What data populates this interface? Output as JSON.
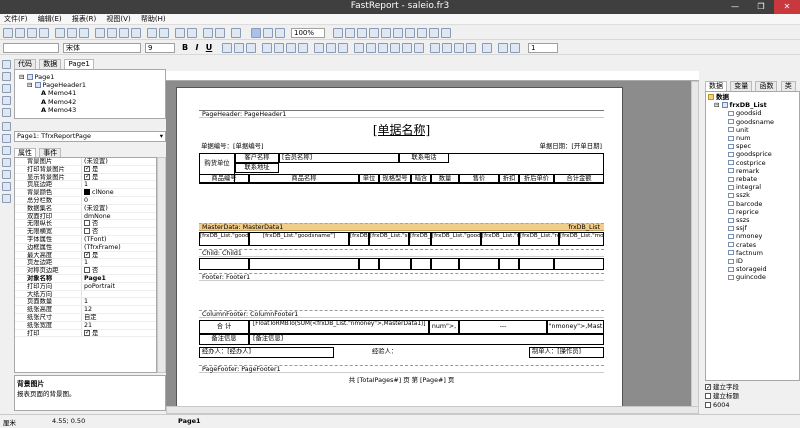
{
  "window": {
    "title": "FastReport - saleio.fr3"
  },
  "menu": [
    "文件(F)",
    "编辑(E)",
    "报表(R)",
    "视图(V)",
    "帮助(H)"
  ],
  "format_toolbar": {
    "font_name": "宋体",
    "font_size": "9",
    "zoom": "100%",
    "line_width": "1"
  },
  "left_tabs": [
    "代码",
    "数据",
    "Page1"
  ],
  "tree": [
    "Page1",
    "PageHeader1",
    "Memo41",
    "Memo42",
    "Memo43"
  ],
  "object_selector": "Page1: TfrxReportPage",
  "prop_tabs": [
    "属性",
    "事件"
  ],
  "props": [
    {
      "k": "背景图片",
      "v": "(未设置)"
    },
    {
      "k": "打印背景图片",
      "v": "是",
      "chk": true
    },
    {
      "k": "显示背景图片",
      "v": "是",
      "chk": true
    },
    {
      "k": "页底边距",
      "v": "1"
    },
    {
      "k": "背景颜色",
      "v": "clNone",
      "sw": true
    },
    {
      "k": "总分栏数",
      "v": "0"
    },
    {
      "k": "数据集名",
      "v": "(未设置)"
    },
    {
      "k": "双面打印",
      "v": "dmNone"
    },
    {
      "k": "无限纵长",
      "v": "否",
      "chk": false
    },
    {
      "k": "无限横宽",
      "v": "否",
      "chk": false
    },
    {
      "k": "字体属性",
      "v": "(TFont)"
    },
    {
      "k": "边框属性",
      "v": "(TfrxFrame)"
    },
    {
      "k": "最大高度",
      "v": "是",
      "chk": true
    },
    {
      "k": "页左边距",
      "v": "1"
    },
    {
      "k": "对称页边距",
      "v": "否",
      "chk": false
    },
    {
      "k": "对象名称",
      "v": "Page1",
      "bold": true
    },
    {
      "k": "打印方向",
      "v": "poPortrait"
    },
    {
      "k": "大纸方向",
      "v": ""
    },
    {
      "k": "页面数量",
      "v": "1"
    },
    {
      "k": "纸张高度",
      "v": "12"
    },
    {
      "k": "纸张尺寸",
      "v": "自定"
    },
    {
      "k": "纸张宽度",
      "v": "21"
    },
    {
      "k": "打印",
      "v": "是",
      "chk": true
    }
  ],
  "prop_help": {
    "title": "背景图片",
    "desc": "报表页面的背景图。"
  },
  "report": {
    "page_header_label": "PageHeader: PageHeader1",
    "title": "[单据名称]",
    "doc_no": "单据编号：[单据编号]",
    "doc_date": "单据日期：[开单日期]",
    "buy_unit": "购货单位",
    "customer_name_label": "客户名称",
    "customer_name": "[会员名称]",
    "contact_phone": "联系电话",
    "contact_address": "联系地址",
    "columns": [
      "商品编号",
      "商品名称",
      "单位",
      "规格型号",
      "暗含",
      "数量",
      "售价",
      "折扣",
      "折后单价",
      "合计金额"
    ],
    "master_label": "MasterData: MasterData1",
    "master_dataset": "frxDB_List",
    "master_cells": [
      "[frxDB_List.\"goodsid\"]",
      "[frxDB_List.\"goodsname\"]",
      "[frxDB_List.\"un",
      "[frxDB_List.\"spec\"]",
      "[frxDB_List",
      "[frxDB_List.\"goodspr",
      "[frxDB_List.\"re",
      "[frxDB_List.\"repri",
      "[frxDB_List.\"money\"]"
    ],
    "child_label": "Child: Child1",
    "footer_label": "Footer: Footer1",
    "column_footer_label": "ColumnFooter: ColumnFooter1",
    "total_label": "合    计",
    "total_expr": "[FloatToRMBTo(SUM(<frxDB_List.\"nmoney\">,MasterData1)]",
    "total_mid": "num\">,",
    "total_dash": "---",
    "total_right": "\"nmoney\">,Mast",
    "note_label": "备注信息",
    "note_val": "[备注信息]",
    "handler": "经办人：[经办人]",
    "checker": "经验人：",
    "maker": "制单人：[操作员]",
    "page_footer_label": "PageFooter: PageFooter1",
    "page_footer_text": "共 [TotalPages#] 页 第 [Page#] 页"
  },
  "right_tabs": [
    "数据",
    "变量",
    "函数",
    "类"
  ],
  "data_tree_root": "数据",
  "data_dataset": "frxDB_List",
  "data_fields": [
    "goodsid",
    "goodsname",
    "unit",
    "num",
    "spec",
    "goodsprice",
    "costprice",
    "remark",
    "rebate",
    "integral",
    "sszk",
    "barcode",
    "reprice",
    "sszs",
    "ssjf",
    "nmoney",
    "crates",
    "factnum",
    "ID",
    "storageid",
    "guincode"
  ],
  "right_options": [
    {
      "label": "建立字段",
      "on": true
    },
    {
      "label": "建立标题",
      "on": false
    },
    {
      "label": "6004",
      "on": false
    }
  ],
  "status": {
    "unit": "厘米",
    "coords": "4.55; 0.50",
    "page": "Page1"
  }
}
